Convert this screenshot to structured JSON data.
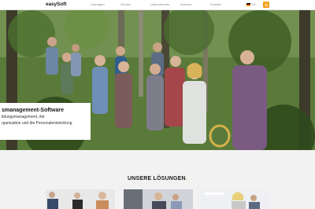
{
  "nav": {
    "logo": "easySoft",
    "menu": [
      {
        "label": "Lösungen"
      },
      {
        "label": "Service"
      },
      {
        "label": "Unternehmen"
      },
      {
        "label": "Karriere"
      },
      {
        "label": "Kontakt"
      }
    ],
    "lang": "DE"
  },
  "hero": {
    "title": "smanagement-Software",
    "line1": "ildungsmanagement, die",
    "line2": "rganisation und die Personalentwicklung"
  },
  "section": {
    "title": "UNSERE LÖSUNGEN",
    "title_dot": "."
  },
  "colors": {
    "accent": "#f39c12",
    "forest": "#4e6f32"
  },
  "icons": {
    "search": "search-icon",
    "flag": "flag-de-icon"
  }
}
